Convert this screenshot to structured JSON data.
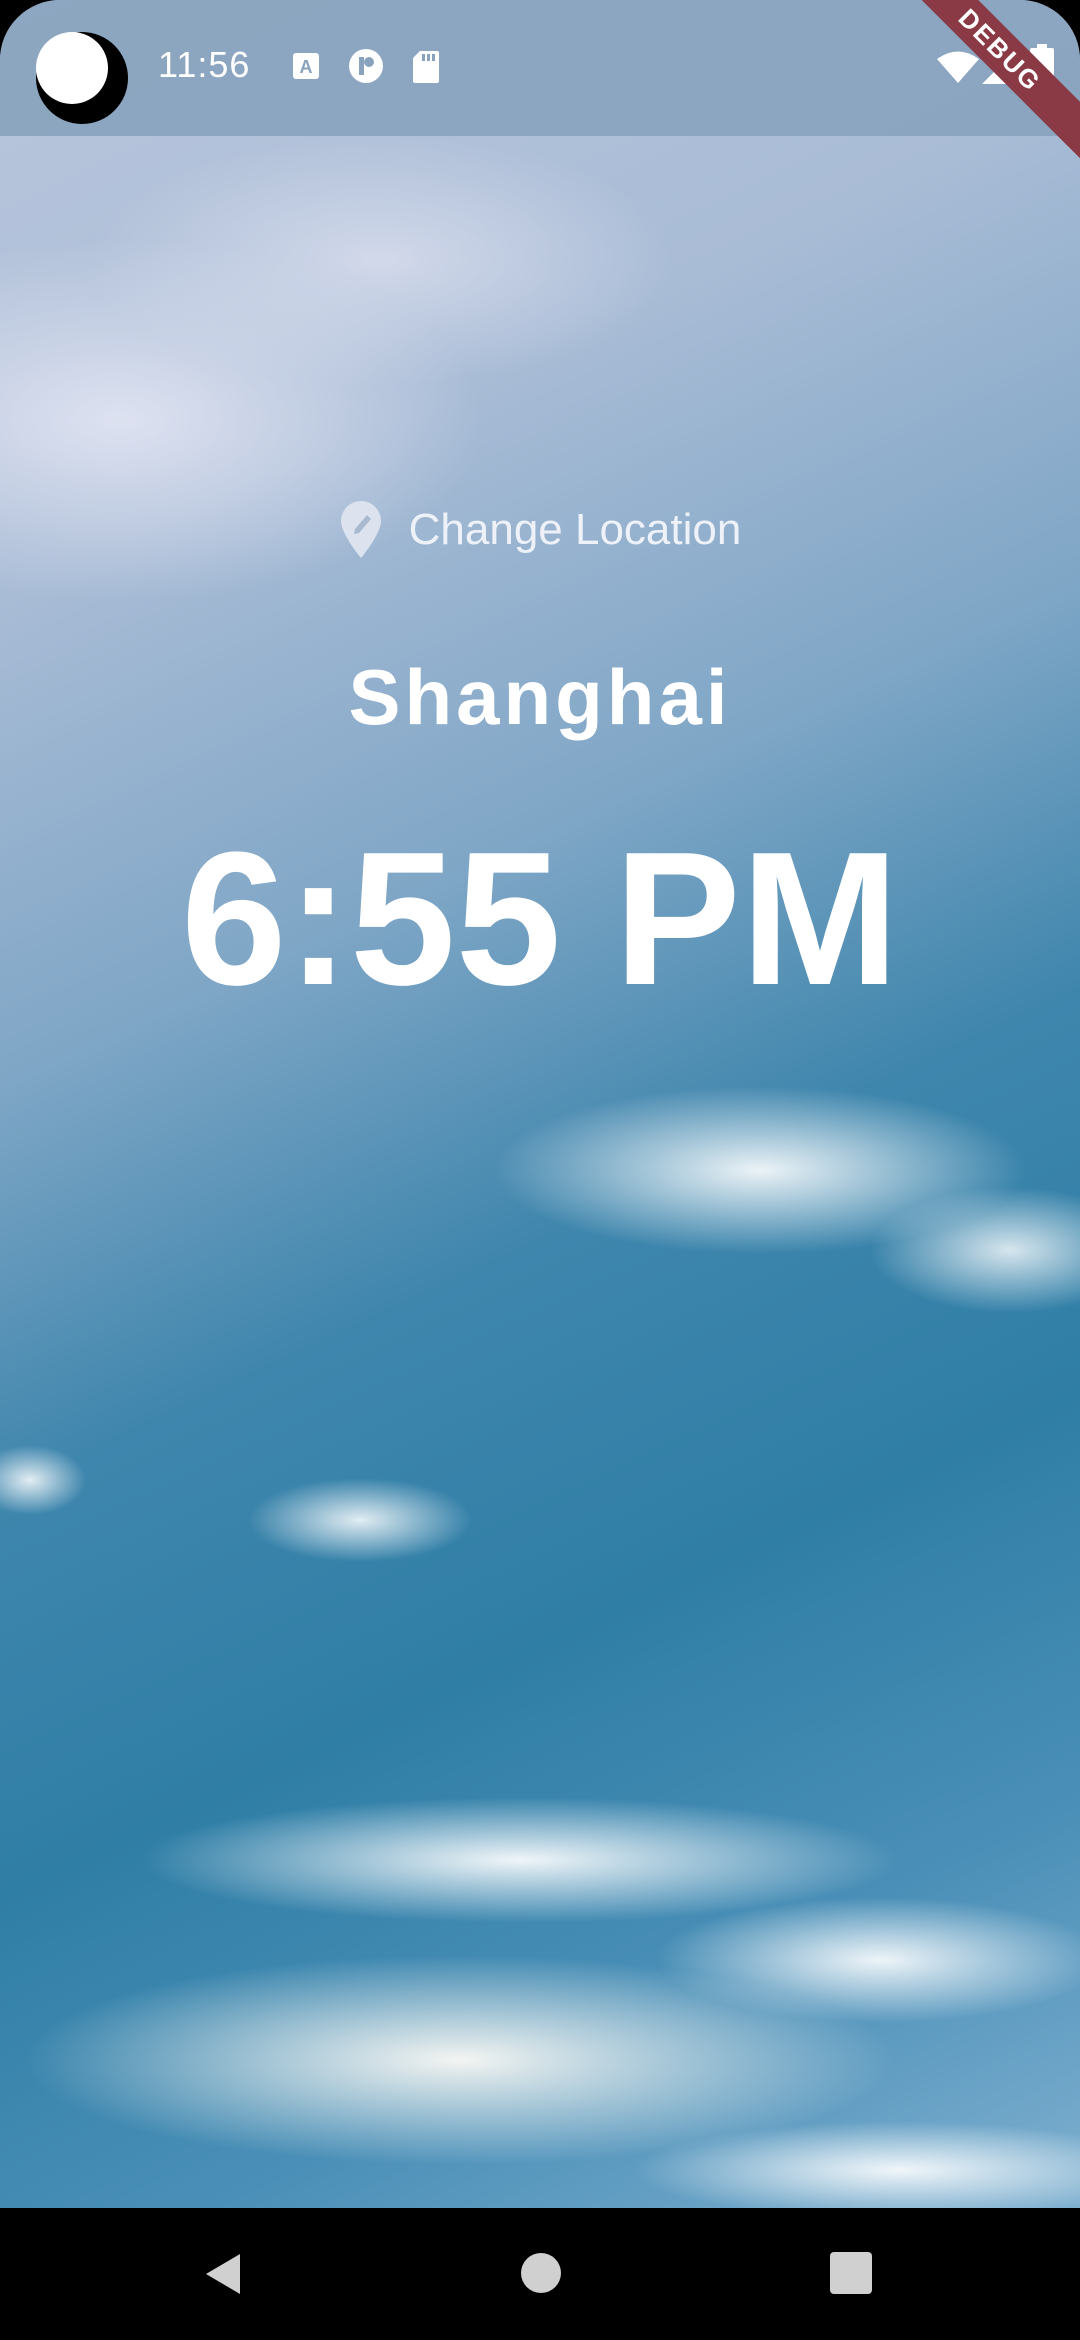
{
  "status_bar": {
    "time": "11:56",
    "icons": [
      "avatar-icon",
      "keyboard-a-icon",
      "app-p-icon",
      "sd-card-icon",
      "wifi-icon",
      "signal-icon",
      "battery-icon"
    ],
    "debug_label": "DEBUG",
    "background": "#89a3be"
  },
  "main": {
    "change_location_label": "Change Location",
    "location_icon": "location-pin-icon",
    "city": "Shanghai",
    "time": "6:55 PM"
  },
  "nav_bar": {
    "buttons": [
      "back-icon",
      "home-icon",
      "recents-icon"
    ]
  },
  "colors": {
    "sky_top": "#b9c6dc",
    "sky_mid": "#3f86ad",
    "text": "#ffffff",
    "debug_ribbon": "#8a3a44"
  }
}
